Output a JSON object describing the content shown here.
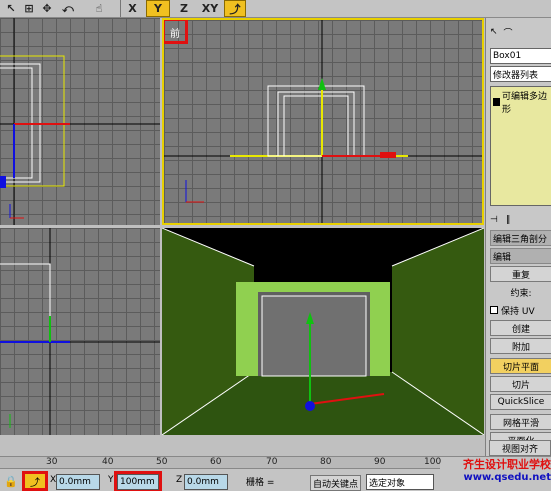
{
  "toolbar": {
    "axis_buttons": [
      "X",
      "Y",
      "Z",
      "XY"
    ]
  },
  "viewports": {
    "front_label": "前"
  },
  "right_panel": {
    "object_name": "Box01",
    "modifier_list": "修改器列表",
    "stack_item": "可编辑多边形",
    "rollout_edit_tri": "编辑三角剖分",
    "rollout_edit": "编辑",
    "repeat": "重复",
    "constraint": "约束:",
    "keep_uv": "保持 UV",
    "create": "创建",
    "attach": "附加",
    "slice_plane": "切片平面",
    "slice": "切片",
    "quickslice": "QuickSlice",
    "grid_align": "网格平滑",
    "planarize": "平面化",
    "view_align": "视图对齐"
  },
  "bottom": {
    "ruler_ticks": [
      "30",
      "40",
      "50",
      "60",
      "70",
      "80",
      "90",
      "100"
    ],
    "x_value": "0.0mm",
    "y_value": "100mm",
    "z_value": "0.0mm",
    "grid_label": "栅格 =",
    "autokey": "自动关键点",
    "selection": "选定对象"
  },
  "logo": {
    "name": "齐生设计职业学校",
    "url": "www.qsedu.net"
  }
}
